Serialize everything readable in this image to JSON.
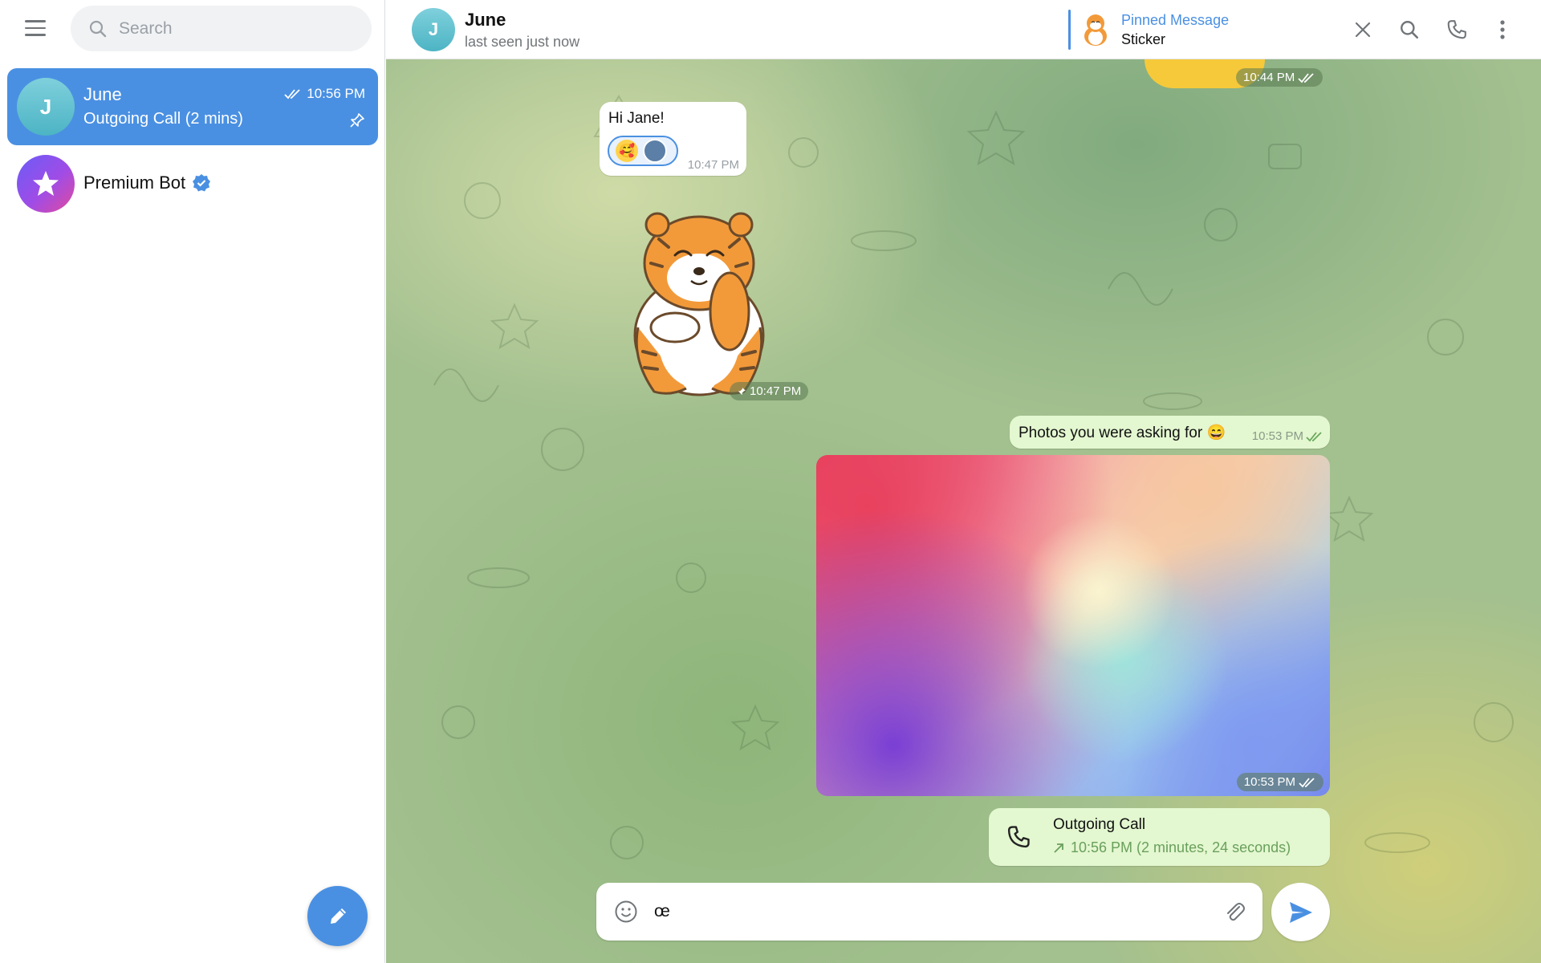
{
  "search": {
    "placeholder": "Search"
  },
  "chat_list": [
    {
      "name": "June",
      "avatar_letter": "J",
      "preview": "Outgoing Call (2 mins)",
      "time": "10:56 PM",
      "pinned": true,
      "active": true
    },
    {
      "name": "Premium Bot",
      "verified": true,
      "active": false
    }
  ],
  "chat": {
    "name": "June",
    "avatar_letter": "J",
    "status": "last seen just now",
    "pinned": {
      "title": "Pinned Message",
      "text": "Sticker"
    }
  },
  "messages": {
    "top_time": "10:44 PM",
    "hi": {
      "text": "Hi Jane!",
      "time": "10:47 PM"
    },
    "sticker": {
      "time": "10:47 PM"
    },
    "photos": {
      "text": "Photos you were asking for 😄",
      "time": "10:53 PM"
    },
    "photo": {
      "time": "10:53 PM"
    },
    "call": {
      "title": "Outgoing Call",
      "detail": "10:56 PM (2 minutes, 24 seconds)"
    }
  },
  "composer": {
    "value": "œ"
  },
  "colors": {
    "accent": "#4a90e2",
    "outgoing_bubble": "#e3f7d0"
  }
}
